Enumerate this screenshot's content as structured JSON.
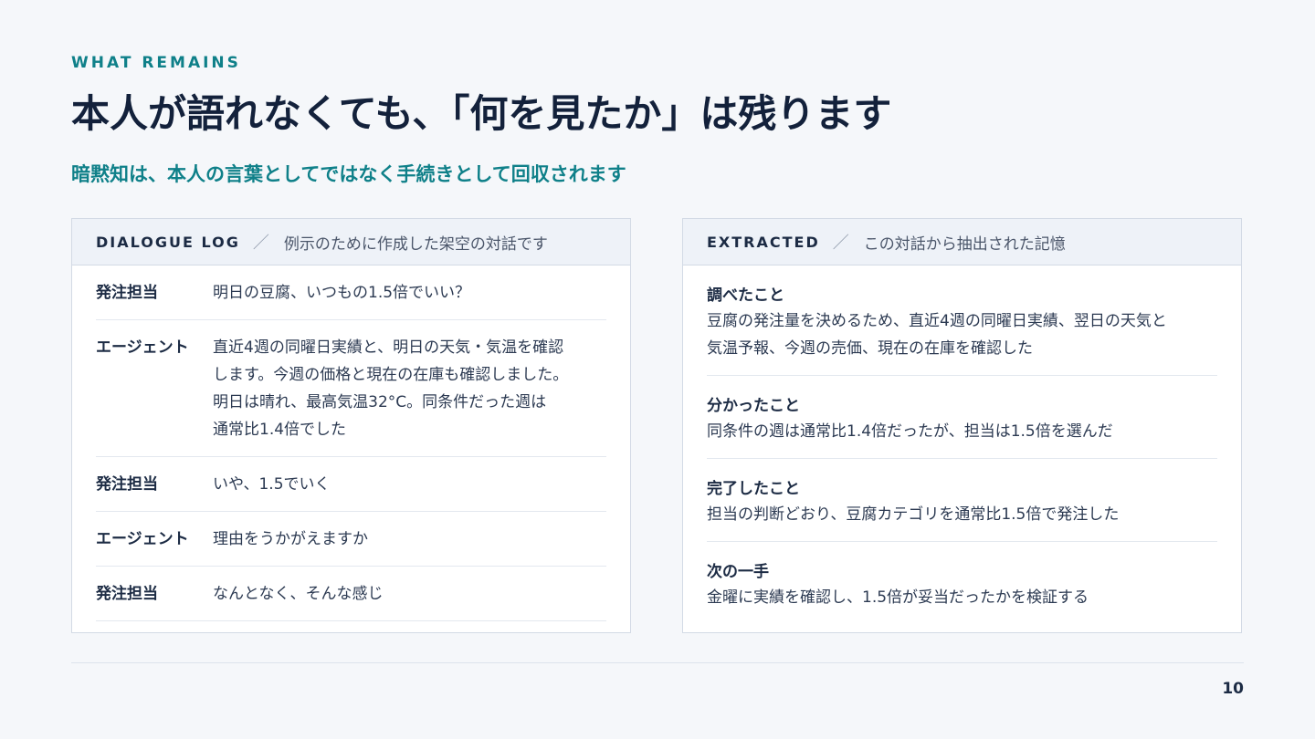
{
  "eyebrow": "WHAT REMAINS",
  "title": "本人が語れなくても、「何を見たか」は残ります",
  "subtitle": "暗黙知は、本人の言葉としてではなく手続きとして回収されます",
  "dialogue": {
    "tag": "DIALOGUE LOG",
    "separator": "／",
    "note": "例示のために作成した架空の対話です",
    "rows": [
      {
        "speaker": "発注担当",
        "lines": [
          "明日の豆腐、いつもの1.5倍でいい？"
        ]
      },
      {
        "speaker": "エージェント",
        "lines": [
          "直近4週の同曜日実績と、明日の天気・気温を確認",
          "します。今週の価格と現在の在庫も確認しました。",
          "明日は晴れ、最高気温32°C。同条件だった週は",
          "通常比1.4倍でした"
        ]
      },
      {
        "speaker": "発注担当",
        "lines": [
          "いや、1.5でいく"
        ]
      },
      {
        "speaker": "エージェント",
        "lines": [
          "理由をうかがえますか"
        ]
      },
      {
        "speaker": "発注担当",
        "lines": [
          "なんとなく、そんな感じ"
        ]
      }
    ]
  },
  "extracted": {
    "tag": "EXTRACTED",
    "separator": "／",
    "note": "この対話から抽出された記憶",
    "items": [
      {
        "label": "調べたこと",
        "lines": [
          "豆腐の発注量を決めるため、直近4週の同曜日実績、翌日の天気と",
          "気温予報、今週の売価、現在の在庫を確認した"
        ]
      },
      {
        "label": "分かったこと",
        "lines": [
          "同条件の週は通常比1.4倍だったが、担当は1.5倍を選んだ"
        ]
      },
      {
        "label": "完了したこと",
        "lines": [
          "担当の判断どおり、豆腐カテゴリを通常比1.5倍で発注した"
        ]
      },
      {
        "label": "次の一手",
        "lines": [
          "金曜に実績を確認し、1.5倍が妥当だったかを検証する"
        ]
      }
    ]
  },
  "page_number": "10"
}
